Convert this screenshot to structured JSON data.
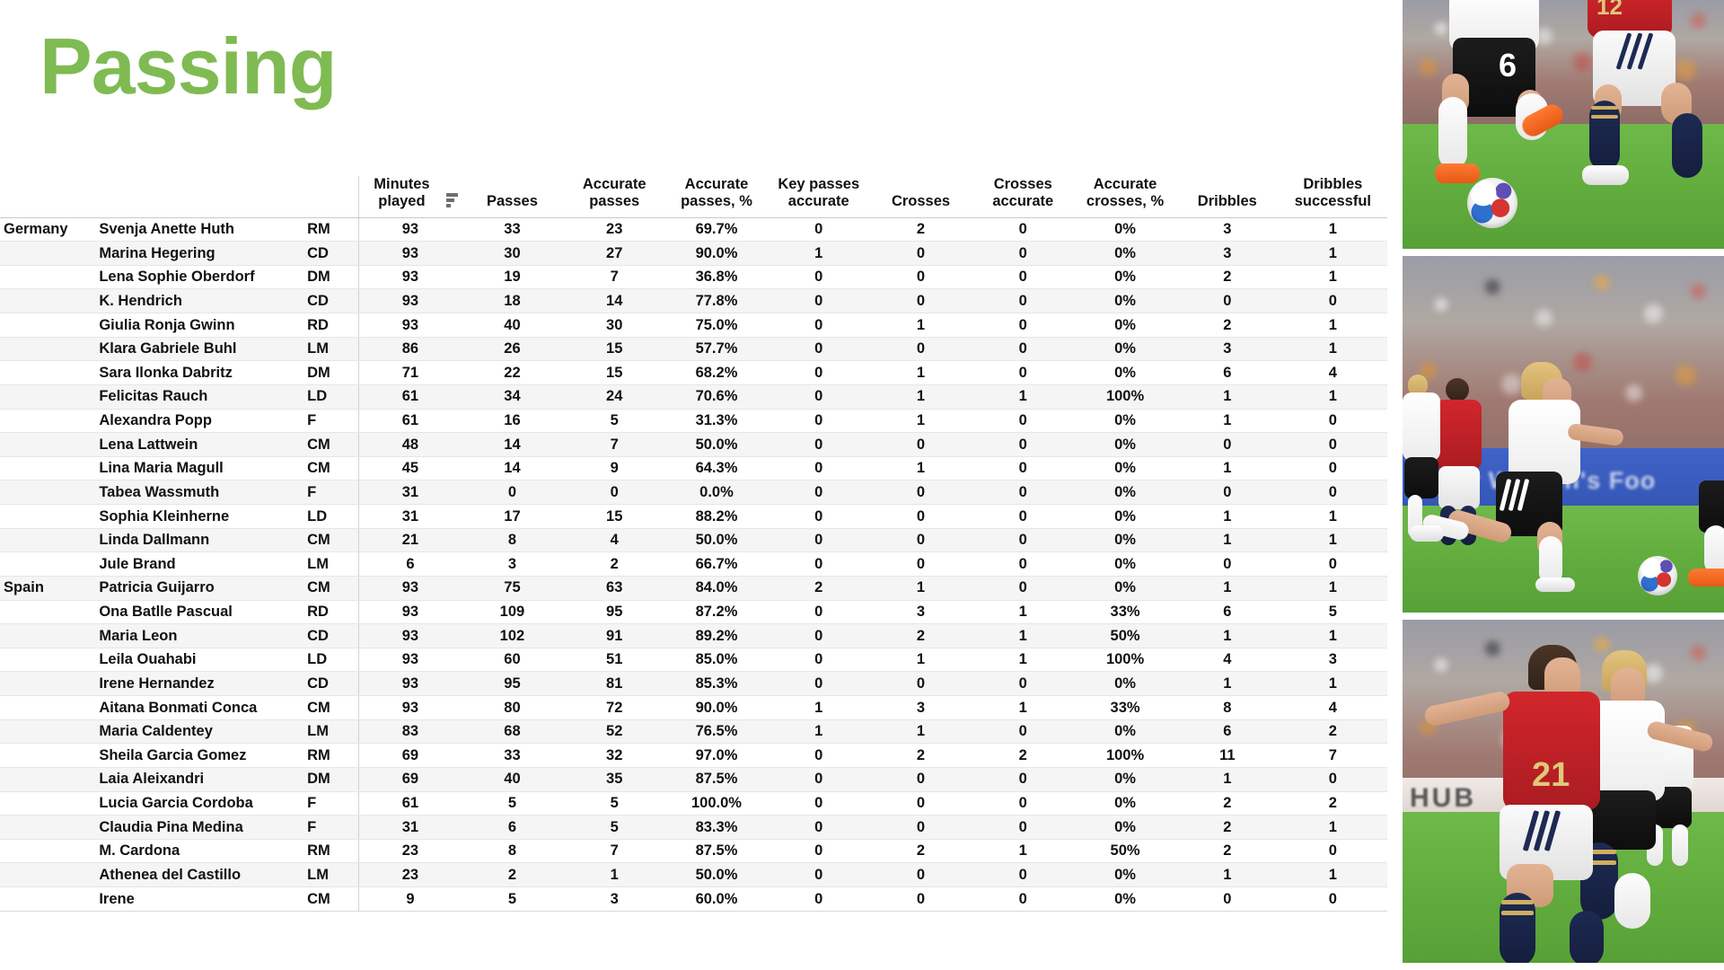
{
  "title": "Passing",
  "title_color": "#7fbb52",
  "table": {
    "headers": {
      "team": "",
      "player": "",
      "position": "",
      "columns": [
        "Minutes played",
        "Passes",
        "Accurate passes",
        "Accurate passes, %",
        "Key passes accurate",
        "Crosses",
        "Crosses accurate",
        "Accurate crosses, %",
        "Dribbles",
        "Dribbles successful"
      ]
    },
    "sort": {
      "column": "Minutes played",
      "direction": "descending",
      "icon": "sort-descending-icon"
    },
    "rows": [
      {
        "team": "Germany",
        "player": "Svenja Anette Huth",
        "position": "RM",
        "minutes": "93",
        "passes": "33",
        "accurate_passes": "23",
        "accurate_passes_pct": "69.7%",
        "key_passes_accurate": "0",
        "crosses": "2",
        "crosses_accurate": "0",
        "accurate_crosses_pct": "0%",
        "dribbles": "3",
        "dribbles_successful": "1"
      },
      {
        "team": "",
        "player": "Marina Hegering",
        "position": "CD",
        "minutes": "93",
        "passes": "30",
        "accurate_passes": "27",
        "accurate_passes_pct": "90.0%",
        "key_passes_accurate": "1",
        "crosses": "0",
        "crosses_accurate": "0",
        "accurate_crosses_pct": "0%",
        "dribbles": "3",
        "dribbles_successful": "1"
      },
      {
        "team": "",
        "player": "Lena Sophie Oberdorf",
        "position": "DM",
        "minutes": "93",
        "passes": "19",
        "accurate_passes": "7",
        "accurate_passes_pct": "36.8%",
        "key_passes_accurate": "0",
        "crosses": "0",
        "crosses_accurate": "0",
        "accurate_crosses_pct": "0%",
        "dribbles": "2",
        "dribbles_successful": "1"
      },
      {
        "team": "",
        "player": "K. Hendrich",
        "position": "CD",
        "minutes": "93",
        "passes": "18",
        "accurate_passes": "14",
        "accurate_passes_pct": "77.8%",
        "key_passes_accurate": "0",
        "crosses": "0",
        "crosses_accurate": "0",
        "accurate_crosses_pct": "0%",
        "dribbles": "0",
        "dribbles_successful": "0"
      },
      {
        "team": "",
        "player": "Giulia Ronja Gwinn",
        "position": "RD",
        "minutes": "93",
        "passes": "40",
        "accurate_passes": "30",
        "accurate_passes_pct": "75.0%",
        "key_passes_accurate": "0",
        "crosses": "1",
        "crosses_accurate": "0",
        "accurate_crosses_pct": "0%",
        "dribbles": "2",
        "dribbles_successful": "1"
      },
      {
        "team": "",
        "player": "Klara Gabriele Buhl",
        "position": "LM",
        "minutes": "86",
        "passes": "26",
        "accurate_passes": "15",
        "accurate_passes_pct": "57.7%",
        "key_passes_accurate": "0",
        "crosses": "0",
        "crosses_accurate": "0",
        "accurate_crosses_pct": "0%",
        "dribbles": "3",
        "dribbles_successful": "1"
      },
      {
        "team": "",
        "player": "Sara Ilonka Dabritz",
        "position": "DM",
        "minutes": "71",
        "passes": "22",
        "accurate_passes": "15",
        "accurate_passes_pct": "68.2%",
        "key_passes_accurate": "0",
        "crosses": "1",
        "crosses_accurate": "0",
        "accurate_crosses_pct": "0%",
        "dribbles": "6",
        "dribbles_successful": "4"
      },
      {
        "team": "",
        "player": "Felicitas Rauch",
        "position": "LD",
        "minutes": "61",
        "passes": "34",
        "accurate_passes": "24",
        "accurate_passes_pct": "70.6%",
        "key_passes_accurate": "0",
        "crosses": "1",
        "crosses_accurate": "1",
        "accurate_crosses_pct": "100%",
        "dribbles": "1",
        "dribbles_successful": "1"
      },
      {
        "team": "",
        "player": "Alexandra Popp",
        "position": "F",
        "minutes": "61",
        "passes": "16",
        "accurate_passes": "5",
        "accurate_passes_pct": "31.3%",
        "key_passes_accurate": "0",
        "crosses": "1",
        "crosses_accurate": "0",
        "accurate_crosses_pct": "0%",
        "dribbles": "1",
        "dribbles_successful": "0"
      },
      {
        "team": "",
        "player": "Lena Lattwein",
        "position": "CM",
        "minutes": "48",
        "passes": "14",
        "accurate_passes": "7",
        "accurate_passes_pct": "50.0%",
        "key_passes_accurate": "0",
        "crosses": "0",
        "crosses_accurate": "0",
        "accurate_crosses_pct": "0%",
        "dribbles": "0",
        "dribbles_successful": "0"
      },
      {
        "team": "",
        "player": "Lina Maria Magull",
        "position": "CM",
        "minutes": "45",
        "passes": "14",
        "accurate_passes": "9",
        "accurate_passes_pct": "64.3%",
        "key_passes_accurate": "0",
        "crosses": "1",
        "crosses_accurate": "0",
        "accurate_crosses_pct": "0%",
        "dribbles": "1",
        "dribbles_successful": "0"
      },
      {
        "team": "",
        "player": "Tabea Wassmuth",
        "position": "F",
        "minutes": "31",
        "passes": "0",
        "accurate_passes": "0",
        "accurate_passes_pct": "0.0%",
        "key_passes_accurate": "0",
        "crosses": "0",
        "crosses_accurate": "0",
        "accurate_crosses_pct": "0%",
        "dribbles": "0",
        "dribbles_successful": "0"
      },
      {
        "team": "",
        "player": "Sophia Kleinherne",
        "position": "LD",
        "minutes": "31",
        "passes": "17",
        "accurate_passes": "15",
        "accurate_passes_pct": "88.2%",
        "key_passes_accurate": "0",
        "crosses": "0",
        "crosses_accurate": "0",
        "accurate_crosses_pct": "0%",
        "dribbles": "1",
        "dribbles_successful": "1"
      },
      {
        "team": "",
        "player": "Linda Dallmann",
        "position": "CM",
        "minutes": "21",
        "passes": "8",
        "accurate_passes": "4",
        "accurate_passes_pct": "50.0%",
        "key_passes_accurate": "0",
        "crosses": "0",
        "crosses_accurate": "0",
        "accurate_crosses_pct": "0%",
        "dribbles": "1",
        "dribbles_successful": "1"
      },
      {
        "team": "",
        "player": "Jule Brand",
        "position": "LM",
        "minutes": "6",
        "passes": "3",
        "accurate_passes": "2",
        "accurate_passes_pct": "66.7%",
        "key_passes_accurate": "0",
        "crosses": "0",
        "crosses_accurate": "0",
        "accurate_crosses_pct": "0%",
        "dribbles": "0",
        "dribbles_successful": "0"
      },
      {
        "team": "Spain",
        "player": "Patricia Guijarro",
        "position": "CM",
        "minutes": "93",
        "passes": "75",
        "accurate_passes": "63",
        "accurate_passes_pct": "84.0%",
        "key_passes_accurate": "2",
        "crosses": "1",
        "crosses_accurate": "0",
        "accurate_crosses_pct": "0%",
        "dribbles": "1",
        "dribbles_successful": "1"
      },
      {
        "team": "",
        "player": "Ona Batlle Pascual",
        "position": "RD",
        "minutes": "93",
        "passes": "109",
        "accurate_passes": "95",
        "accurate_passes_pct": "87.2%",
        "key_passes_accurate": "0",
        "crosses": "3",
        "crosses_accurate": "1",
        "accurate_crosses_pct": "33%",
        "dribbles": "6",
        "dribbles_successful": "5"
      },
      {
        "team": "",
        "player": "Maria Leon",
        "position": "CD",
        "minutes": "93",
        "passes": "102",
        "accurate_passes": "91",
        "accurate_passes_pct": "89.2%",
        "key_passes_accurate": "0",
        "crosses": "2",
        "crosses_accurate": "1",
        "accurate_crosses_pct": "50%",
        "dribbles": "1",
        "dribbles_successful": "1"
      },
      {
        "team": "",
        "player": "Leila Ouahabi",
        "position": "LD",
        "minutes": "93",
        "passes": "60",
        "accurate_passes": "51",
        "accurate_passes_pct": "85.0%",
        "key_passes_accurate": "0",
        "crosses": "1",
        "crosses_accurate": "1",
        "accurate_crosses_pct": "100%",
        "dribbles": "4",
        "dribbles_successful": "3"
      },
      {
        "team": "",
        "player": "Irene Hernandez",
        "position": "CD",
        "minutes": "93",
        "passes": "95",
        "accurate_passes": "81",
        "accurate_passes_pct": "85.3%",
        "key_passes_accurate": "0",
        "crosses": "0",
        "crosses_accurate": "0",
        "accurate_crosses_pct": "0%",
        "dribbles": "1",
        "dribbles_successful": "1"
      },
      {
        "team": "",
        "player": "Aitana Bonmati Conca",
        "position": "CM",
        "minutes": "93",
        "passes": "80",
        "accurate_passes": "72",
        "accurate_passes_pct": "90.0%",
        "key_passes_accurate": "1",
        "crosses": "3",
        "crosses_accurate": "1",
        "accurate_crosses_pct": "33%",
        "dribbles": "8",
        "dribbles_successful": "4"
      },
      {
        "team": "",
        "player": "Maria Caldentey",
        "position": "LM",
        "minutes": "83",
        "passes": "68",
        "accurate_passes": "52",
        "accurate_passes_pct": "76.5%",
        "key_passes_accurate": "1",
        "crosses": "1",
        "crosses_accurate": "0",
        "accurate_crosses_pct": "0%",
        "dribbles": "6",
        "dribbles_successful": "2"
      },
      {
        "team": "",
        "player": "Sheila Garcia Gomez",
        "position": "RM",
        "minutes": "69",
        "passes": "33",
        "accurate_passes": "32",
        "accurate_passes_pct": "97.0%",
        "key_passes_accurate": "0",
        "crosses": "2",
        "crosses_accurate": "2",
        "accurate_crosses_pct": "100%",
        "dribbles": "11",
        "dribbles_successful": "7"
      },
      {
        "team": "",
        "player": "Laia Aleixandri",
        "position": "DM",
        "minutes": "69",
        "passes": "40",
        "accurate_passes": "35",
        "accurate_passes_pct": "87.5%",
        "key_passes_accurate": "0",
        "crosses": "0",
        "crosses_accurate": "0",
        "accurate_crosses_pct": "0%",
        "dribbles": "1",
        "dribbles_successful": "0"
      },
      {
        "team": "",
        "player": "Lucia Garcia Cordoba",
        "position": "F",
        "minutes": "61",
        "passes": "5",
        "accurate_passes": "5",
        "accurate_passes_pct": "100.0%",
        "key_passes_accurate": "0",
        "crosses": "0",
        "crosses_accurate": "0",
        "accurate_crosses_pct": "0%",
        "dribbles": "2",
        "dribbles_successful": "2"
      },
      {
        "team": "",
        "player": "Claudia Pina Medina",
        "position": "F",
        "minutes": "31",
        "passes": "6",
        "accurate_passes": "5",
        "accurate_passes_pct": "83.3%",
        "key_passes_accurate": "0",
        "crosses": "0",
        "crosses_accurate": "0",
        "accurate_crosses_pct": "0%",
        "dribbles": "2",
        "dribbles_successful": "1"
      },
      {
        "team": "",
        "player": "M. Cardona",
        "position": "RM",
        "minutes": "23",
        "passes": "8",
        "accurate_passes": "7",
        "accurate_passes_pct": "87.5%",
        "key_passes_accurate": "0",
        "crosses": "2",
        "crosses_accurate": "1",
        "accurate_crosses_pct": "50%",
        "dribbles": "2",
        "dribbles_successful": "0"
      },
      {
        "team": "",
        "player": "Athenea del Castillo",
        "position": "LM",
        "minutes": "23",
        "passes": "2",
        "accurate_passes": "1",
        "accurate_passes_pct": "50.0%",
        "key_passes_accurate": "0",
        "crosses": "0",
        "crosses_accurate": "0",
        "accurate_crosses_pct": "0%",
        "dribbles": "1",
        "dribbles_successful": "1"
      },
      {
        "team": "",
        "player": "Irene",
        "position": "CM",
        "minutes": "9",
        "passes": "5",
        "accurate_passes": "3",
        "accurate_passes_pct": "60.0%",
        "key_passes_accurate": "0",
        "crosses": "0",
        "crosses_accurate": "0",
        "accurate_crosses_pct": "0%",
        "dribbles": "0",
        "dribbles_successful": "0"
      }
    ]
  },
  "photos": [
    {
      "name": "match-photo-legs-duel",
      "advert_text": ""
    },
    {
      "name": "match-photo-germany-player",
      "advert_text": "r Women's Foo"
    },
    {
      "name": "match-photo-spain-germany-duel",
      "advert_text": "HUB"
    }
  ]
}
